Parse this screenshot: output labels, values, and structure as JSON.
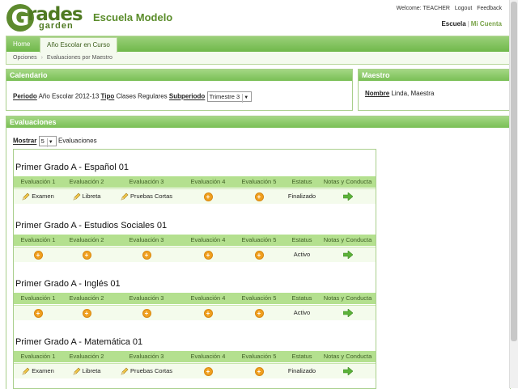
{
  "header": {
    "logo_main": "rades",
    "logo_g": "G",
    "logo_sub": "garden",
    "school_name": "Escuela Modelo",
    "welcome": "Welcome: TEACHER",
    "logout": "Logout",
    "feedback": "Feedback",
    "account_current": "Escuela",
    "account_link": "Mi Cuenta"
  },
  "nav": {
    "tabs": [
      "Home",
      "Año Escolar en Curso"
    ],
    "breadcrumb": [
      "Opciones",
      "Evaluaciones por Maestro"
    ]
  },
  "calendario": {
    "title": "Calendario",
    "periodo_label": "Periodo",
    "periodo_value": "Año Escolar 2012-13",
    "tipo_label": "Tipo",
    "tipo_value": "Clases Regulares",
    "subperiodo_label": "Subperiodo",
    "subperiodo_value": "Trimestre 3"
  },
  "maestro": {
    "title": "Maestro",
    "nombre_label": "Nombre",
    "nombre_value": "Linda, Maestra"
  },
  "evaluaciones": {
    "title": "Evaluaciones",
    "mostrar_label": "Mostrar",
    "mostrar_value": "5",
    "mostrar_suffix": "Evaluaciones",
    "columns": [
      "Evaluación 1",
      "Evaluación 2",
      "Evaluación 3",
      "Evaluación 4",
      "Evaluación 5",
      "Estatus",
      "Notas y Conducta"
    ],
    "courses": [
      {
        "title": "Primer Grado A - Español 01",
        "e1": "Examen",
        "e2": "Libreta",
        "e3": "Pruebas Cortas",
        "status": "Finalizado"
      },
      {
        "title": "Primer Grado A - Estudios Sociales 01",
        "e1": "",
        "e2": "",
        "e3": "",
        "status": "Activo"
      },
      {
        "title": "Primer Grado A - Inglés 01",
        "e1": "",
        "e2": "",
        "e3": "",
        "status": "Activo"
      },
      {
        "title": "Primer Grado A - Matemática 01",
        "e1": "Examen",
        "e2": "Libreta",
        "e3": "Pruebas Cortas",
        "status": "Finalizado"
      }
    ]
  },
  "colors": {
    "accent": "#79bf55",
    "header_band": "#b4e08f",
    "add_icon": "#f0a020"
  }
}
